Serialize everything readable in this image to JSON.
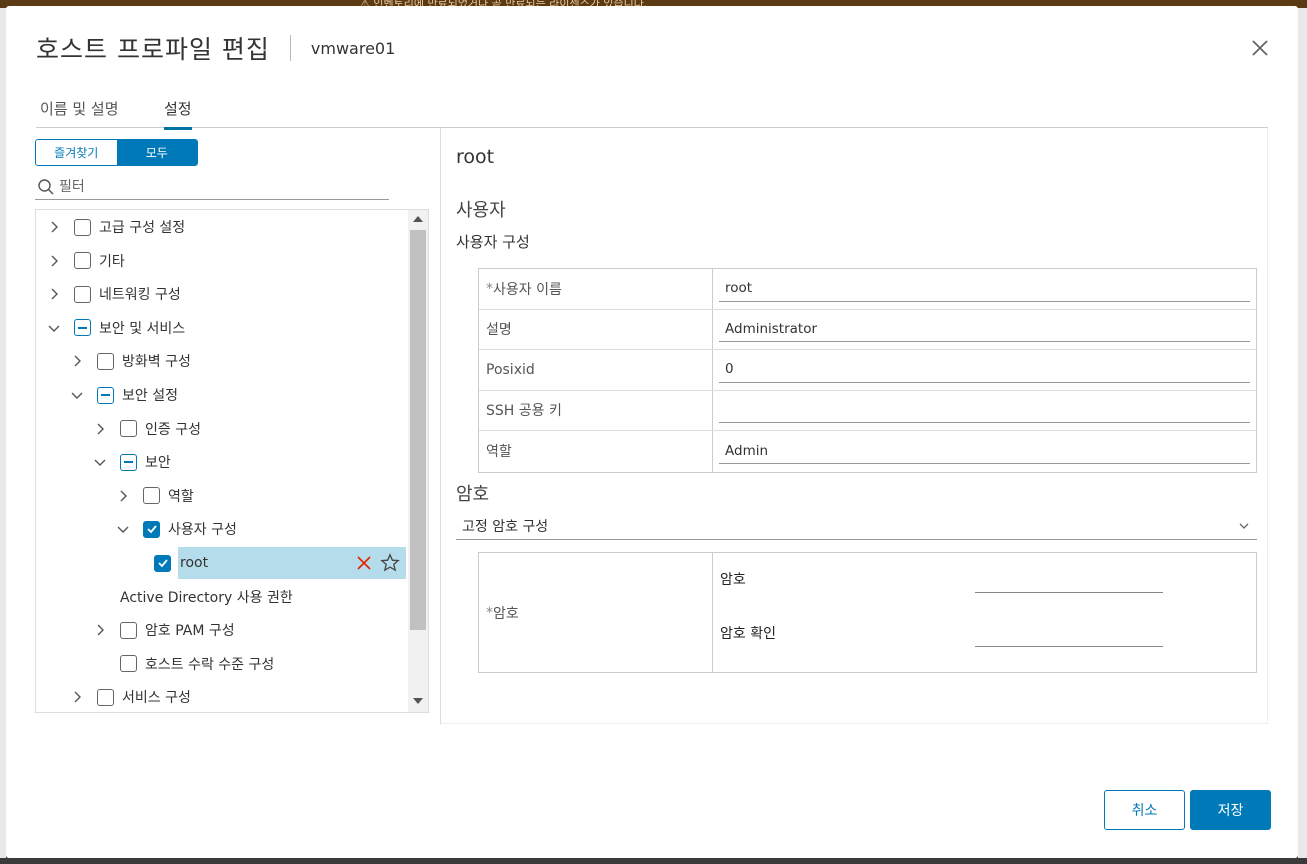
{
  "background": {
    "banner_text": "⚠ 인벤토리에 만료되었거나 곧 만료되는 라이센스가 있습니다."
  },
  "dialog": {
    "title": "호스트 프로파일 편집",
    "subtitle": "vmware01"
  },
  "tabs": [
    {
      "label": "이름 및 설명",
      "active": false
    },
    {
      "label": "설정",
      "active": true
    }
  ],
  "filter_toggle": {
    "favorites_label": "즐겨찾기",
    "all_label": "모두",
    "selected": "all"
  },
  "filter": {
    "placeholder": "필터"
  },
  "tree": [
    {
      "label": "고급 구성 설정",
      "level": 0,
      "expand": "collapsed",
      "check": "unchecked"
    },
    {
      "label": "기타",
      "level": 0,
      "expand": "collapsed",
      "check": "unchecked"
    },
    {
      "label": "네트워킹 구성",
      "level": 0,
      "expand": "collapsed",
      "check": "unchecked"
    },
    {
      "label": "보안 및 서비스",
      "level": 0,
      "expand": "expanded",
      "check": "indeterminate"
    },
    {
      "label": "방화벽 구성",
      "level": 1,
      "expand": "collapsed",
      "check": "unchecked"
    },
    {
      "label": "보안 설정",
      "level": 1,
      "expand": "expanded",
      "check": "indeterminate"
    },
    {
      "label": "인증 구성",
      "level": 2,
      "expand": "collapsed",
      "check": "unchecked"
    },
    {
      "label": "보안",
      "level": 2,
      "expand": "expanded",
      "check": "indeterminate"
    },
    {
      "label": "역할",
      "level": 3,
      "expand": "collapsed",
      "check": "unchecked"
    },
    {
      "label": "사용자 구성",
      "level": 3,
      "expand": "expanded",
      "check": "checked"
    },
    {
      "label": "root",
      "level": 4,
      "expand": "none",
      "check": "checked",
      "selected": true
    },
    {
      "label": "Active Directory 사용 권한",
      "level": 2,
      "expand": "none",
      "check": "none"
    },
    {
      "label": "암호 PAM 구성",
      "level": 2,
      "expand": "collapsed",
      "check": "unchecked"
    },
    {
      "label": "호스트 수락 수준 구성",
      "level": 2,
      "expand": "none",
      "check": "unchecked"
    },
    {
      "label": "서비스 구성",
      "level": 1,
      "expand": "collapsed",
      "check": "unchecked"
    }
  ],
  "detail": {
    "title": "root",
    "section": "사용자",
    "subsection": "사용자 구성",
    "fields": [
      {
        "label": "사용자 이름",
        "required": true,
        "value": "root"
      },
      {
        "label": "설명",
        "required": false,
        "value": "Administrator"
      },
      {
        "label": "Posixid",
        "required": false,
        "value": "0"
      },
      {
        "label": "SSH 공용 키",
        "required": false,
        "value": ""
      },
      {
        "label": "역할",
        "required": false,
        "value": "Admin"
      }
    ],
    "password_section": "암호",
    "password_mode": "고정 암호 구성",
    "password_label": "암호",
    "password_field": "암호",
    "password_confirm_field": "암호 확인"
  },
  "buttons": {
    "cancel": "취소",
    "save": "저장"
  },
  "colors": {
    "primary": "#0079b8",
    "selected_row": "#b5dcea",
    "delete_icon": "#e02200"
  }
}
